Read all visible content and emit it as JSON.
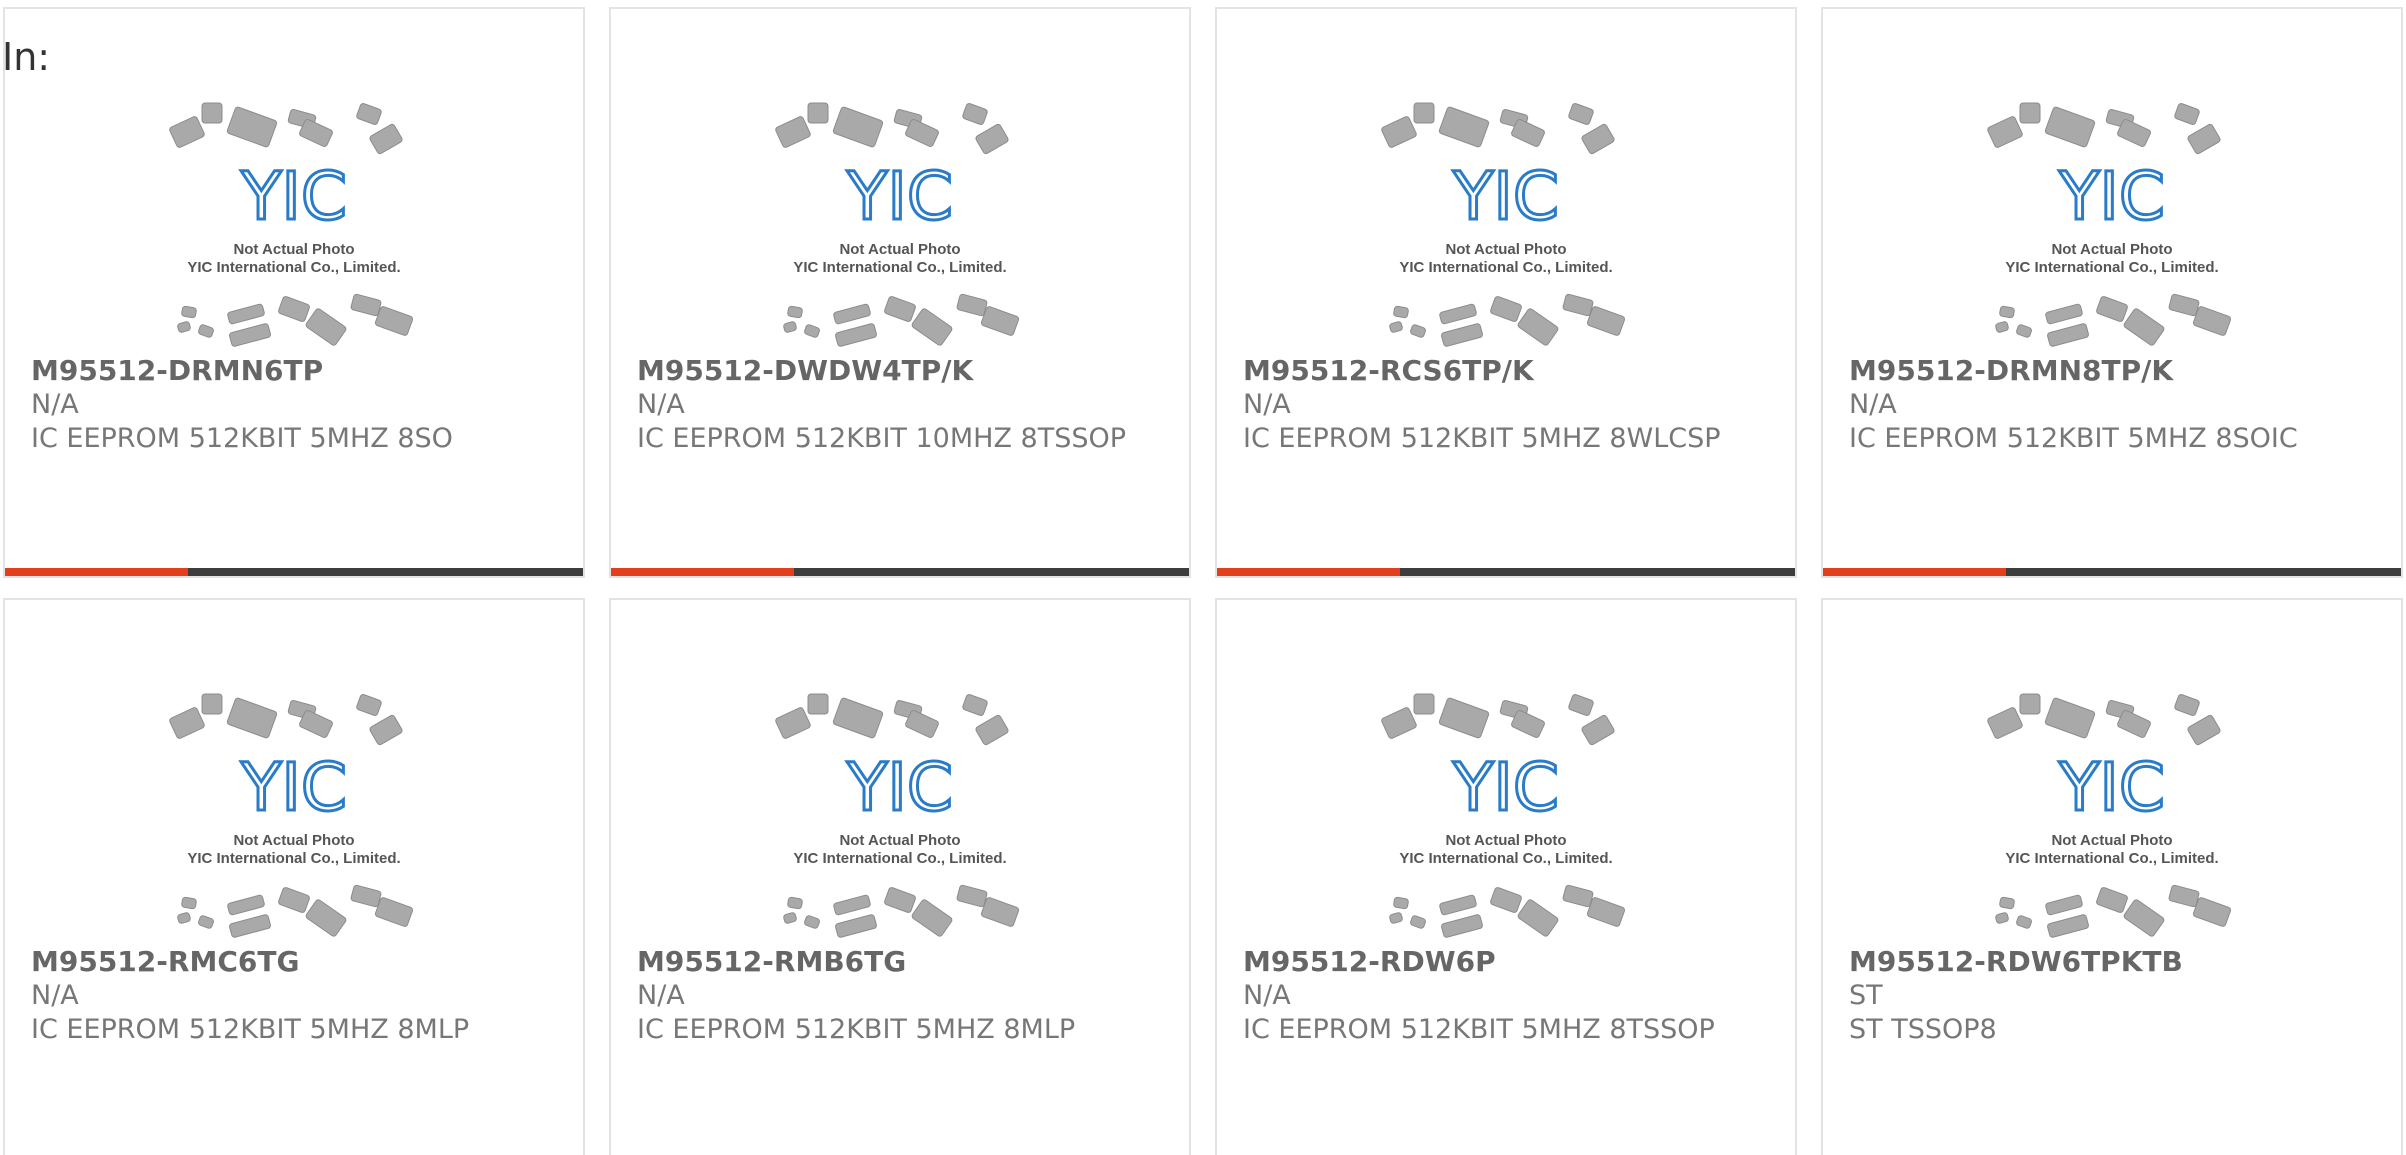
{
  "header": {
    "in_label": "In:"
  },
  "theme": {
    "accent": "#e2401c",
    "bar_dark": "#3d3d3d",
    "logo_blue": "#2a7bc8"
  },
  "placeholder_photo": {
    "line1": "Not Actual Photo",
    "line2": "YIC International Co., Limited.",
    "logo_text": "YIC"
  },
  "products": [
    {
      "name": "M95512-DRMN6TP",
      "manufacturer": "N/A",
      "description": "IC EEPROM 512KBIT 5MHZ 8SO"
    },
    {
      "name": "M95512-DWDW4TP/K",
      "manufacturer": "N/A",
      "description": "IC EEPROM 512KBIT 10MHZ 8TSSOP"
    },
    {
      "name": "M95512-RCS6TP/K",
      "manufacturer": "N/A",
      "description": "IC EEPROM 512KBIT 5MHZ 8WLCSP"
    },
    {
      "name": "M95512-DRMN8TP/K",
      "manufacturer": "N/A",
      "description": "IC EEPROM 512KBIT 5MHZ 8SOIC"
    },
    {
      "name": "M95512-RMC6TG",
      "manufacturer": "N/A",
      "description": "IC EEPROM 512KBIT 5MHZ 8MLP"
    },
    {
      "name": "M95512-RMB6TG",
      "manufacturer": "N/A",
      "description": "IC EEPROM 512KBIT 5MHZ 8MLP"
    },
    {
      "name": "M95512-RDW6P",
      "manufacturer": "N/A",
      "description": "IC EEPROM 512KBIT 5MHZ 8TSSOP"
    },
    {
      "name": "M95512-RDW6TPKTB",
      "manufacturer": "ST",
      "description": "ST TSSOP8"
    }
  ]
}
